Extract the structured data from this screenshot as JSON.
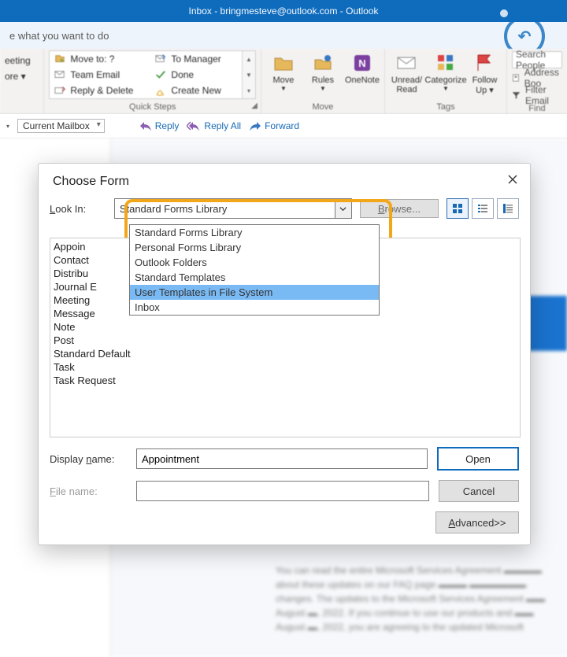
{
  "title": "Inbox - bringmesteve@outlook.com  -  Outlook",
  "tellme": "e what you want to do",
  "ribbon": {
    "meeting": {
      "line1": "eeting",
      "line2": "ore ▾"
    },
    "quick_steps": {
      "label": "Quick Steps",
      "items": [
        "Move to: ?",
        "To Manager",
        "Team Email",
        "Done",
        "Reply & Delete",
        "Create New"
      ]
    },
    "move": {
      "label": "Move",
      "buttons": [
        "Move",
        "Rules",
        "OneNote"
      ]
    },
    "tags": {
      "label": "Tags",
      "buttons": [
        "Unread/\nRead",
        "Categorize",
        "Follow\nUp ▾"
      ]
    },
    "find": {
      "label": "Find",
      "search_ph": "Search People",
      "address": "Address Boo",
      "filter": "Filter Email"
    }
  },
  "toolbar": {
    "combo": "Current Mailbox",
    "reply": "Reply",
    "reply_all": "Reply All",
    "forward": "Forward"
  },
  "dialog": {
    "title": "Choose Form",
    "look_in_label": "Look In:",
    "browse": "Browse...",
    "selected_look_in": "Standard Forms Library",
    "dd_options": [
      "Standard Forms Library",
      "Personal Forms Library",
      "Outlook Folders",
      "Standard Templates",
      "User Templates in File System",
      "Inbox"
    ],
    "dd_selected_index": 4,
    "form_items": [
      "Appoin",
      "Contact",
      "Distribu",
      "Journal E",
      "Meeting",
      "Message",
      "Note",
      "Post",
      "Standard Default",
      "Task",
      "Task Request"
    ],
    "display_name_label": "Display name:",
    "display_name_value": "Appointment",
    "file_name_label": "File name:",
    "file_name_value": "",
    "open": "Open",
    "cancel": "Cancel",
    "advanced": "Advanced>>"
  }
}
